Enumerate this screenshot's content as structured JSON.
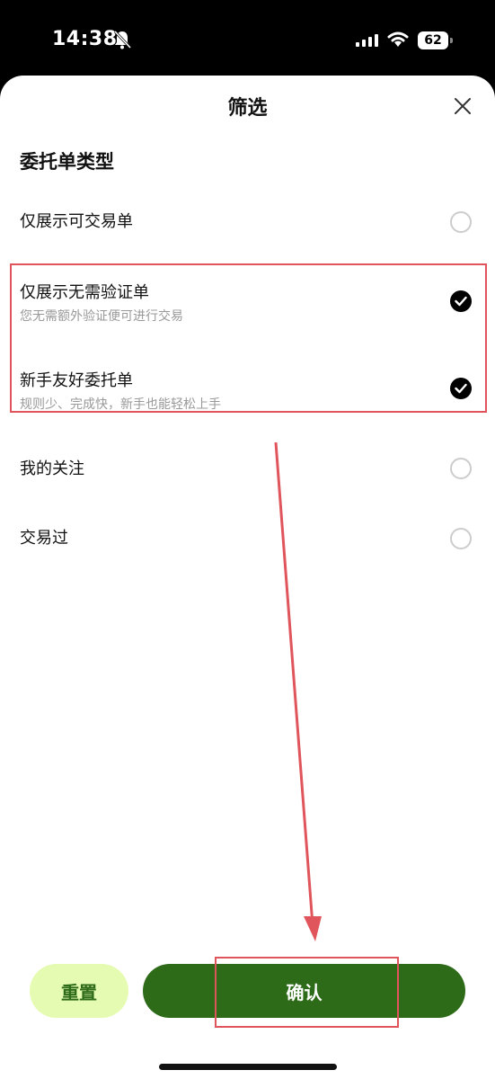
{
  "status_bar": {
    "time": "14:38",
    "battery": "62"
  },
  "sheet": {
    "title": "筛选",
    "section_title": "委托单类型",
    "options": [
      {
        "label": "仅展示可交易单",
        "checked": false
      },
      {
        "label": "仅展示无需验证单",
        "sublabel": "您无需额外验证便可进行交易",
        "checked": true
      },
      {
        "label": "新手友好委托单",
        "sublabel": "规则少、完成快，新手也能轻松上手",
        "checked": true
      },
      {
        "label": "我的关注",
        "checked": false
      },
      {
        "label": "交易过",
        "checked": false
      }
    ]
  },
  "buttons": {
    "reset": "重置",
    "confirm": "确认"
  },
  "colors": {
    "accent_green": "#2e6b18",
    "light_green": "#e6fbb2",
    "highlight_red": "#e0555b"
  }
}
